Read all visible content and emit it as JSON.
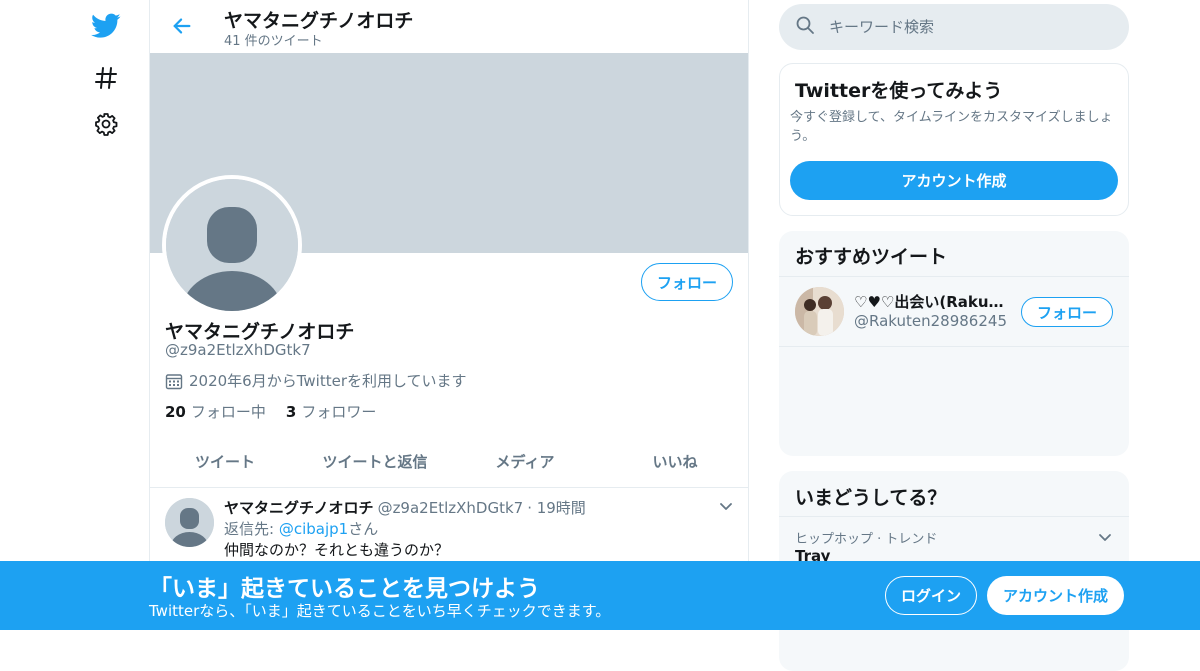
{
  "colors": {
    "accent": "#1da1f2",
    "banner": "#ccd6dd",
    "secondary_text": "#657786",
    "panel_bg": "#f5f8fa"
  },
  "nav": {
    "items": [
      {
        "icon": "twitter-bird-icon"
      },
      {
        "icon": "hashtag-icon"
      },
      {
        "icon": "gear-icon"
      }
    ]
  },
  "header": {
    "title": "ヤマタニグチノオロチ",
    "tweet_count": "41 件のツイート"
  },
  "profile": {
    "name": "ヤマタニグチノオロチ",
    "handle": "@z9a2EtlzXhDGtk7",
    "joined": "2020年6月からTwitterを利用しています",
    "following_count": "20",
    "following_label": "フォロー中",
    "followers_count": "3",
    "followers_label": "フォロワー",
    "follow_label": "フォロー"
  },
  "tabs": [
    "ツイート",
    "ツイートと返信",
    "メディア",
    "いいね"
  ],
  "tweet": {
    "name": "ヤマタニグチノオロチ",
    "handle": "@z9a2EtlzXhDGtk7",
    "time": "· 19時間",
    "reply_prefix": "返信先: ",
    "reply_mention": "@cibajp1",
    "reply_suffix": "さん",
    "text": "仲間なのか？それとも違うのか？"
  },
  "search": {
    "placeholder": "キーワード検索"
  },
  "signup_card": {
    "title": "Twitterを使ってみよう",
    "text": "今すぐ登録して、タイムラインをカスタマイズしましょう。",
    "button": "アカウント作成"
  },
  "recommended": {
    "title": "おすすめツイート",
    "name": "♡♥♡出会い(Rakuten",
    "handle": "@Rakuten28986245",
    "follow_label": "フォロー"
  },
  "trends": {
    "title": "いまどうしてる？",
    "meta": "ヒップホップ · トレンド",
    "name": "Tray"
  },
  "bottom_bar": {
    "title": "「いま」起きていることを見つけよう",
    "subtitle": "Twitterなら、「いま」起きていることをいち早くチェックできます。",
    "login": "ログイン",
    "create": "アカウント作成"
  }
}
